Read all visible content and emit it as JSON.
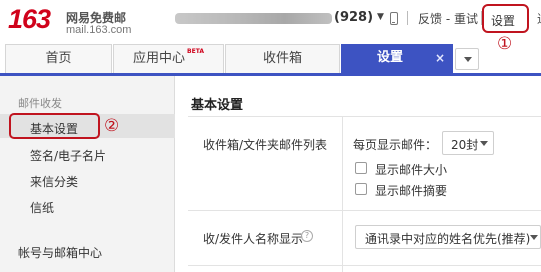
{
  "header": {
    "logo_number": "163",
    "logo_name": "网易免费邮",
    "logo_domain": "mail.163.com",
    "unread_count": "(928)",
    "feedback_label": "反馈 - 重试",
    "settings_label": "设置",
    "more_label": "退",
    "annotation_1": "①"
  },
  "tabs": {
    "items": [
      {
        "label": "首页"
      },
      {
        "label": "应用中心",
        "badge": "BETA"
      },
      {
        "label": "收件箱"
      }
    ],
    "active": {
      "label": "设置",
      "close": "×"
    }
  },
  "sidebar": {
    "section_title": "邮件收发",
    "items": [
      {
        "label": "基本设置"
      },
      {
        "label": "签名/电子名片"
      },
      {
        "label": "来信分类"
      },
      {
        "label": "信纸"
      }
    ],
    "group_title": "帐号与邮箱中心",
    "annotation_2": "②"
  },
  "settings": {
    "title": "基本设置",
    "inbox_row": {
      "label": "收件箱/文件夹邮件列表",
      "per_page_label": "每页显示邮件：",
      "per_page_value": "20封",
      "show_size_label": "显示邮件大小",
      "show_summary_label": "显示邮件摘要"
    },
    "name_row": {
      "label": "收/发件人名称显示",
      "help": "?",
      "value": "通讯录中对应的姓名优先(推荐)"
    }
  },
  "colors": {
    "brand_red": "#d0021b",
    "accent_blue": "#3d53c2",
    "annotation_red": "#c0141f"
  }
}
